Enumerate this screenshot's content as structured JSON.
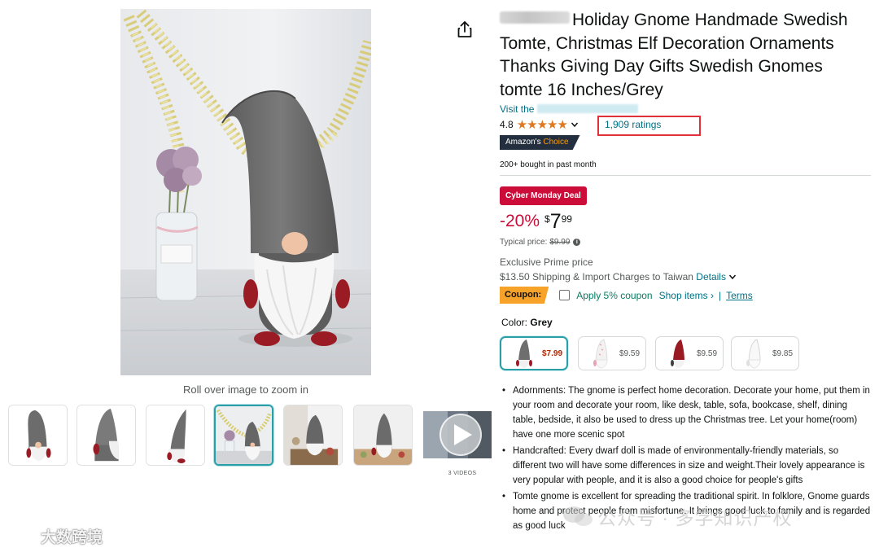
{
  "product": {
    "title": "Holiday Gnome Handmade Swedish Tomte, Christmas Elf Decoration Ornaments Thanks Giving Day Gifts Swedish Gnomes tomte 16 Inches/Grey",
    "store_prefix": "Visit the",
    "rating_value": "4.8",
    "stars": "★★★★★",
    "ratings_count": "1,909 ratings",
    "choice_prefix": "Amazon's",
    "choice_word": "Choice",
    "bought": "200+ bought in past month"
  },
  "gallery": {
    "zoom_hint": "Roll over image to zoom in",
    "videos_label": "3 VIDEOS",
    "selected_index": 3
  },
  "pricing": {
    "deal_badge": "Cyber Monday Deal",
    "discount": "-20%",
    "currency": "$",
    "whole": "7",
    "fraction": "99",
    "typical_label": "Typical price:",
    "typical_price": "$9.99",
    "prime_label": "Exclusive Prime price",
    "shipping_text": "$13.50 Shipping & Import Charges to Taiwan",
    "shipping_details": "Details"
  },
  "coupon": {
    "badge": "Coupon:",
    "text": "Apply 5% coupon",
    "shop_items": "Shop items ›",
    "separator": "|",
    "terms": "Terms"
  },
  "color": {
    "label": "Color:",
    "selected": "Grey",
    "options": [
      {
        "price": "$7.99",
        "hat": "#6e6e6e"
      },
      {
        "price": "$9.59",
        "hat": "#f4f1f1"
      },
      {
        "price": "$9.59",
        "hat": "#9a1a24"
      },
      {
        "price": "$9.85",
        "hat": "#f8f8f8"
      }
    ]
  },
  "bullets": [
    "Adornments: The gnome is perfect home decoration. Decorate your home, put them in your room and decorate your room, like desk, table, sofa, bookcase, shelf, dining table, bedside, it also be used to dress up the Christmas tree. Let your home(room) have one more scenic spot",
    "Handcrafted: Every dwarf doll is made of environmentally-friendly materials, so different two will have some differences in size and weight.Their lovely appearance is very popular with people, and it is also a good choice for people's gifts",
    "Tomte gnome is excellent for spreading the traditional spirit. In folklore, Gnome guards home and protect people from misfortune. It brings good luck to family and is regarded as good luck"
  ],
  "watermarks": {
    "left": "大数跨境",
    "right": "公众号 · 多学知识产权"
  },
  "colors": {
    "link": "#007185",
    "deal": "#cc0c39",
    "star": "#de7921",
    "coupon_badge": "#f7a229",
    "coupon_text": "#067d62",
    "highlight_box": "#e0303a",
    "selected_border": "#2a9fa8"
  }
}
